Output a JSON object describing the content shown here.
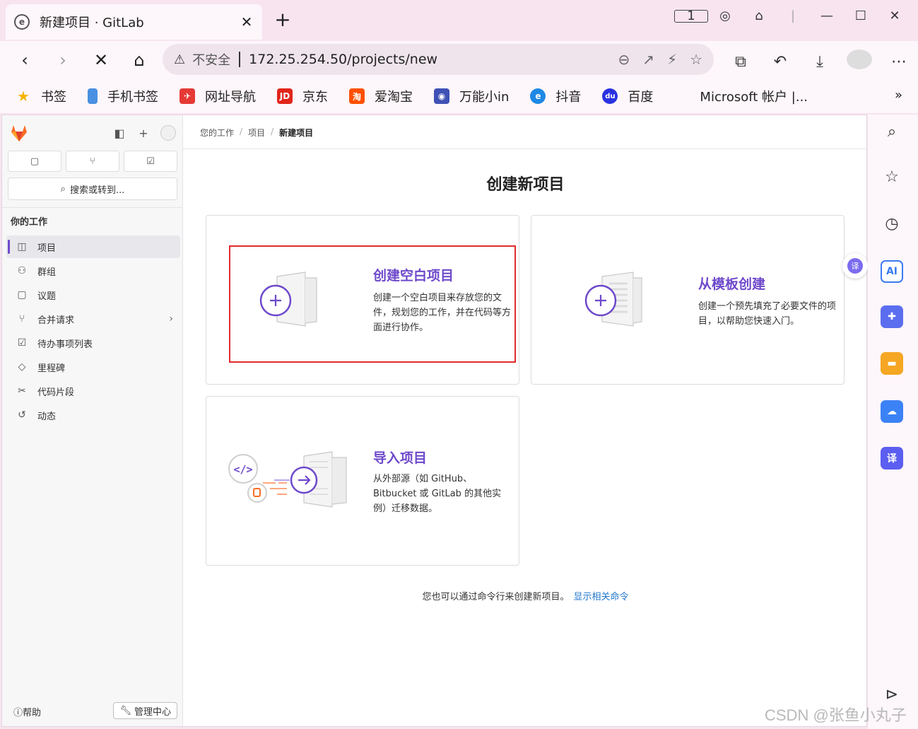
{
  "browser": {
    "tab_title": "新建项目 · GitLab",
    "tab_close": "✕",
    "new_tab": "+",
    "insecure_label": "不安全",
    "url": "172.25.254.50/projects/new",
    "tab_count": "1"
  },
  "bookmarks": [
    {
      "label": "书签",
      "icon": "star-icon",
      "color": "#f4b400",
      "glyph": "★"
    },
    {
      "label": "手机书签",
      "icon": "phone-icon",
      "color": "#4a90e2",
      "glyph": ""
    },
    {
      "label": "网址导航",
      "icon": "nav-icon",
      "color": "#e53935",
      "glyph": "✈"
    },
    {
      "label": "京东",
      "icon": "jd-icon",
      "color": "#e1251b",
      "glyph": "JD"
    },
    {
      "label": "爱淘宝",
      "icon": "taobao-icon",
      "color": "#ff5000",
      "glyph": "淘"
    },
    {
      "label": "万能小in",
      "icon": "robot-icon",
      "color": "#3f51b5",
      "glyph": "◉"
    },
    {
      "label": "抖音",
      "icon": "e-icon",
      "color": "#1e88e5",
      "glyph": "e"
    },
    {
      "label": "百度",
      "icon": "baidu-icon",
      "color": "#2932e1",
      "glyph": "du"
    },
    {
      "label": "Microsoft 帐户 |...",
      "icon": "microsoft-icon",
      "color": "#f25022",
      "glyph": ""
    }
  ],
  "bookmarks_more": "»",
  "sidebar": {
    "search_label": "搜索或转到...",
    "section_title": "你的工作",
    "items": [
      {
        "label": "项目",
        "icon": "project-icon",
        "glyph": "◫",
        "active": true
      },
      {
        "label": "群组",
        "icon": "group-icon",
        "glyph": "⚇"
      },
      {
        "label": "议题",
        "icon": "issue-icon",
        "glyph": "▢"
      },
      {
        "label": "合并请求",
        "icon": "merge-request-icon",
        "glyph": "⑂",
        "chevron": "›"
      },
      {
        "label": "待办事项列表",
        "icon": "todo-icon",
        "glyph": "☑"
      },
      {
        "label": "里程碑",
        "icon": "milestone-icon",
        "glyph": "◇"
      },
      {
        "label": "代码片段",
        "icon": "snippet-icon",
        "glyph": "✂"
      },
      {
        "label": "动态",
        "icon": "activity-icon",
        "glyph": "↺"
      }
    ],
    "help_label": "帮助",
    "admin_label": "管理中心"
  },
  "main": {
    "breadcrumb": [
      "您的工作",
      "项目",
      "新建项目"
    ],
    "page_title": "创建新项目",
    "cards": [
      {
        "title": "创建空白项目",
        "desc": "创建一个空白项目来存放您的文件，规划您的工作，并在代码等方面进行协作。"
      },
      {
        "title": "从模板创建",
        "desc": "创建一个预先填充了必要文件的项目，以帮助您快速入门。"
      },
      {
        "title": "导入项目",
        "desc": "从外部源（如 GitHub、Bitbucket 或 GitLab 的其他实例）迁移数据。"
      }
    ],
    "cli_note": "您也可以通过命令行来创建新项目。",
    "cli_link": "显示相关命令"
  },
  "edge_apps": [
    {
      "name": "ai-icon",
      "glyph": "AI",
      "color": "#3b7bf0"
    },
    {
      "name": "game-icon",
      "glyph": "✚",
      "color": "#5b6ef0"
    },
    {
      "name": "toolbox-icon",
      "glyph": "▬",
      "color": "#f5a623"
    },
    {
      "name": "cloud-icon",
      "glyph": "☁",
      "color": "#3b82f6"
    },
    {
      "name": "translate-icon",
      "glyph": "译",
      "color": "#5b5ef0"
    }
  ],
  "translate_float": "译",
  "watermark": "CSDN @张鱼小丸子",
  "colors": {
    "accent": "#6e49cb",
    "highlight": "#e02c2c",
    "link": "#1f75cb"
  }
}
